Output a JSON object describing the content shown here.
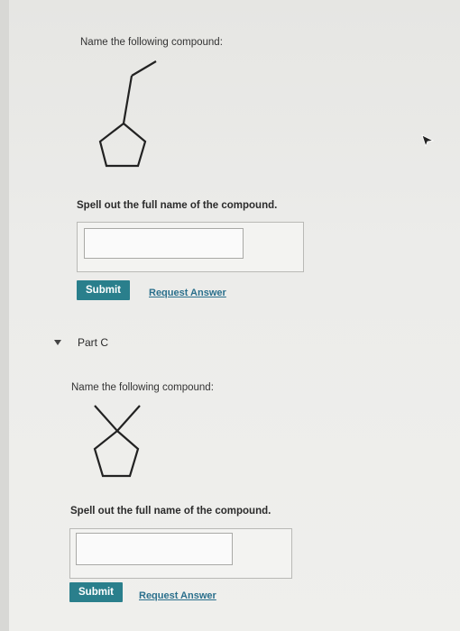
{
  "part_b": {
    "prompt": "Name the following compound:",
    "structure_icon": "ethylcyclopentane-structure-icon",
    "instruction": "Spell out the full name of the compound.",
    "answer_value": "",
    "submit_label": "Submit",
    "request_label": "Request Answer"
  },
  "part_c": {
    "header": "Part C",
    "prompt": "Name the following compound:",
    "structure_icon": "dimethylcyclopentane-structure-icon",
    "instruction": "Spell out the full name of the compound.",
    "answer_value": "",
    "submit_label": "Submit",
    "request_label": "Request Answer"
  },
  "colors": {
    "submit_bg": "#2a7f8c",
    "link": "#2a6f8c"
  }
}
